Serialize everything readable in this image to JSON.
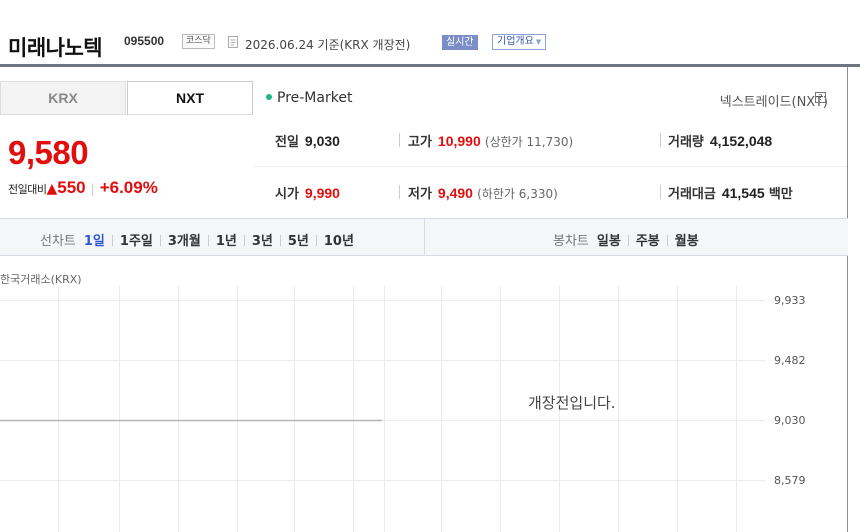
{
  "header": {
    "stock_name": "미래나노텍",
    "stock_code": "095500",
    "market_badge": "코스닥",
    "basis_text": "2026.06.24 기준(KRX 개장전)",
    "realtime_label": "실시간",
    "company_overview_label": "기업개요"
  },
  "market_tabs": [
    {
      "label": "KRX",
      "active": false
    },
    {
      "label": "NXT",
      "active": true
    }
  ],
  "session": {
    "status": "Pre-Market",
    "indicator_color": "#1fb585",
    "nxt_link": "넥스트레이드(NXT)"
  },
  "quote": {
    "price": "9,580",
    "change_label": "전일대비",
    "change_symbol": "▲",
    "change_amount": "550",
    "change_percent": "+6.09%",
    "up_color": "#e10e0e"
  },
  "info": {
    "prev_close": {
      "label": "전일",
      "value": "9,030"
    },
    "high": {
      "label": "고가",
      "value": "10,990",
      "sub_label": "(상한가",
      "sub_value": "11,730",
      "sub_close": ")"
    },
    "volume": {
      "label": "거래량",
      "value": "4,152,048"
    },
    "open": {
      "label": "시가",
      "value": "9,990"
    },
    "low": {
      "label": "저가",
      "value": "9,490",
      "sub_label": "(하한가",
      "sub_value": "6,330",
      "sub_close": ")"
    },
    "trade_value": {
      "label": "거래대금",
      "value": "41,545",
      "unit": "백만"
    }
  },
  "chart_toolbar": {
    "line_chart_title": "선차트",
    "line_periods": [
      {
        "label": "1일",
        "active": true
      },
      {
        "label": "1주일",
        "active": false
      },
      {
        "label": "3개월",
        "active": false
      },
      {
        "label": "1년",
        "active": false
      },
      {
        "label": "3년",
        "active": false
      },
      {
        "label": "5년",
        "active": false
      },
      {
        "label": "10년",
        "active": false
      }
    ],
    "candle_chart_title": "봉차트",
    "candle_periods": [
      {
        "label": "일봉"
      },
      {
        "label": "주봉"
      },
      {
        "label": "월봉"
      }
    ]
  },
  "chart": {
    "source_label": "한국거래소(KRX)",
    "notice": "개장전입니다.",
    "y_ticks": [
      "9,933",
      "9,482",
      "9,030",
      "8,579"
    ],
    "baseline_value": "9,030"
  }
}
